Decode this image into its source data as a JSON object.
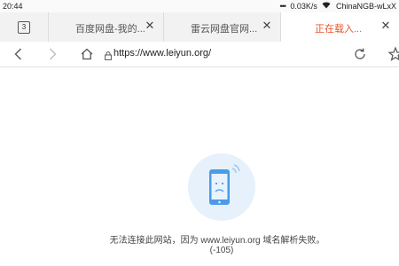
{
  "status_bar": {
    "time": "20:44",
    "dots": "•••",
    "speed": "0.03K/s",
    "network": "ChinaNGB-wLxX"
  },
  "tabs": {
    "count": "3",
    "items": [
      {
        "title": "百度网盘-我的..."
      },
      {
        "title": "雷云网盘官网..."
      },
      {
        "title": "正在载入..."
      }
    ]
  },
  "address_bar": {
    "url": "https://www.leiyun.org/"
  },
  "error": {
    "message": "无法连接此网站，因为 www.leiyun.org 域名解析失败。",
    "code": "(-105)"
  },
  "colors": {
    "accent": "#e8532b",
    "illustration_bg": "#e6f1fc",
    "phone_blue": "#4a9be8"
  },
  "icons": [
    "back-icon",
    "forward-icon",
    "home-icon",
    "lock-icon",
    "refresh-icon",
    "bookmark-star-icon",
    "wifi-icon",
    "close-icon",
    "phone-sad-icon"
  ]
}
